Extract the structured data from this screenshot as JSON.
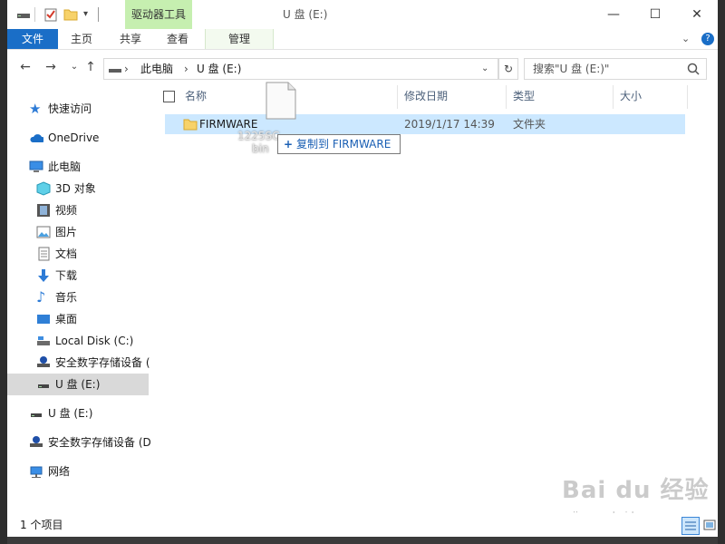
{
  "window": {
    "contextual_tab_group": "驱动器工具",
    "title": "U 盘 (E:)"
  },
  "ribbon": {
    "tabs": [
      "文件",
      "主页",
      "共享",
      "查看",
      "管理"
    ]
  },
  "address_bar": {
    "crumbs": [
      "此电脑",
      "U 盘 (E:)"
    ],
    "search_placeholder": "搜索\"U 盘 (E:)\""
  },
  "nav_pane": {
    "items": [
      {
        "label": "快速访问",
        "icon": "star-icon"
      },
      {
        "label": "OneDrive",
        "icon": "cloud-icon"
      },
      {
        "label": "此电脑",
        "icon": "computer-icon"
      },
      {
        "label": "3D 对象",
        "icon": "3d-objects-icon"
      },
      {
        "label": "视频",
        "icon": "video-icon"
      },
      {
        "label": "图片",
        "icon": "pictures-icon"
      },
      {
        "label": "文档",
        "icon": "documents-icon"
      },
      {
        "label": "下载",
        "icon": "download-icon"
      },
      {
        "label": "音乐",
        "icon": "music-icon"
      },
      {
        "label": "桌面",
        "icon": "desktop-icon"
      },
      {
        "label": "Local Disk (C:)",
        "icon": "drive-icon"
      },
      {
        "label": "安全数字存储设备 (",
        "icon": "sd-card-icon"
      },
      {
        "label": "U 盘 (E:)",
        "icon": "usb-drive-icon",
        "selected": true
      },
      {
        "label": "U 盘 (E:)",
        "icon": "usb-drive-icon"
      },
      {
        "label": "安全数字存储设备 (D",
        "icon": "sd-card-icon"
      },
      {
        "label": "网络",
        "icon": "network-icon"
      }
    ]
  },
  "columns": [
    "名称",
    "修改日期",
    "类型",
    "大小"
  ],
  "files": [
    {
      "name": "FIRMWARE",
      "modified": "2019/1/17 14:39",
      "type": "文件夹",
      "size": ""
    }
  ],
  "drag": {
    "file_name_line1": "1225SC",
    "file_name_line2": "bin",
    "tooltip": "复制到 FIRMWARE"
  },
  "status_bar": {
    "item_count": "1 个项目"
  },
  "watermark": {
    "brand": "Bai du 经验",
    "url": "jingyan.baidu.com"
  },
  "colors": {
    "accent": "#1a6ec7",
    "contextual_tab": "#c6efb0",
    "selection": "#cce8ff",
    "nav_selected": "#d9d9d9"
  }
}
